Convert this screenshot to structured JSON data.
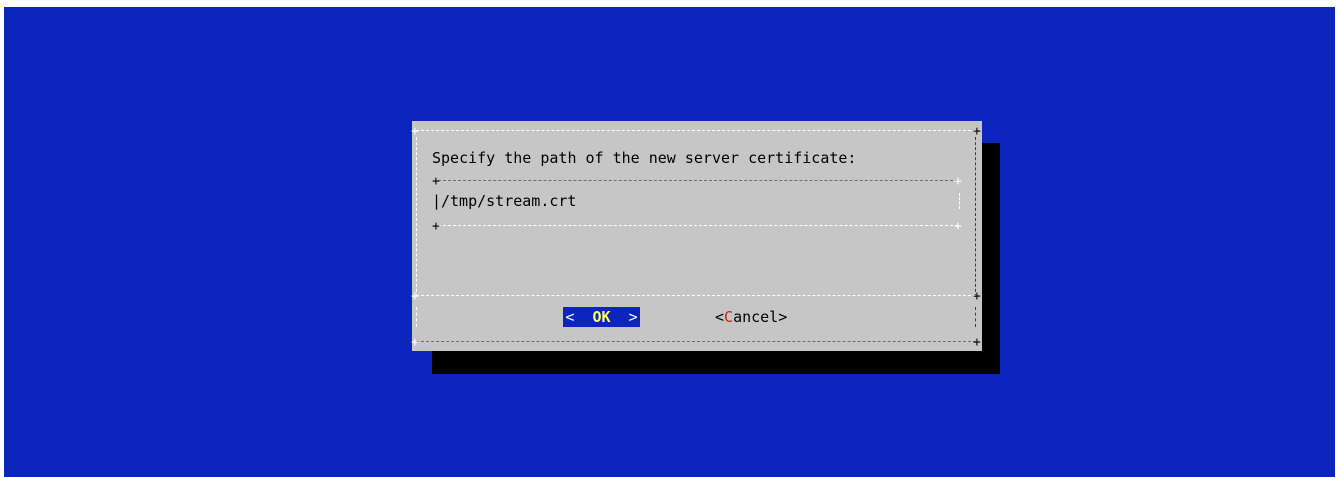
{
  "dialog": {
    "prompt": "Specify the path of the new server certificate:",
    "input_value": "/tmp/stream.crt"
  },
  "buttons": {
    "ok_left": "<",
    "ok_label": "OK",
    "ok_right": ">",
    "cancel_open": "<",
    "cancel_hotkey": "C",
    "cancel_rest": "ancel",
    "cancel_close": ">"
  },
  "colors": {
    "screen_background": "#0b25bd",
    "dialog_background": "#c6c6c6",
    "selected_button_background": "#0b25bd",
    "selected_button_label": "#ffff5a",
    "hotkey": "#c8201c"
  }
}
